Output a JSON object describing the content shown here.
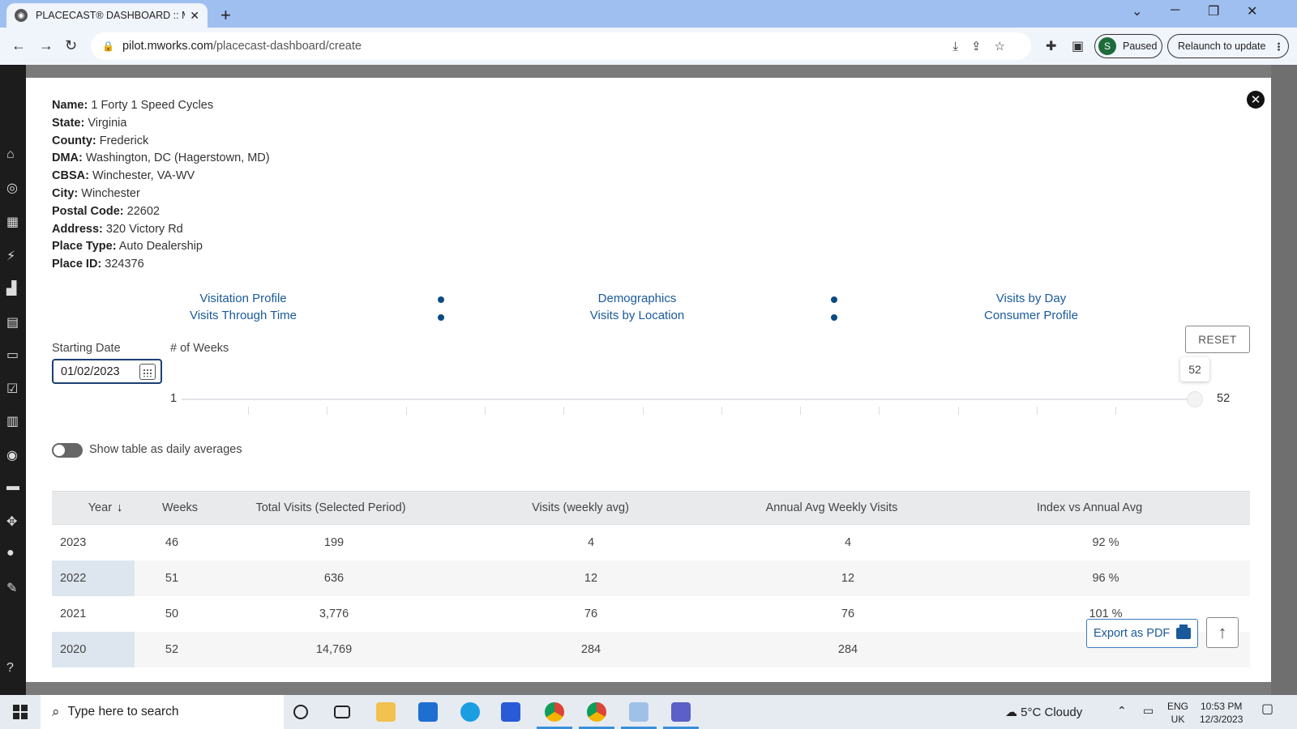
{
  "browser": {
    "tab_title": "PLACECAST® DASHBOARD :: M",
    "url_host": "pilot.mworks.com",
    "url_path": "/placecast-dashboard/create",
    "profile_initial": "S",
    "profile_status": "Paused",
    "relaunch_label": "Relaunch to update"
  },
  "place": {
    "fields": [
      {
        "label": "Name:",
        "value": "1 Forty 1 Speed Cycles"
      },
      {
        "label": "State:",
        "value": "Virginia"
      },
      {
        "label": "County:",
        "value": "Frederick"
      },
      {
        "label": "DMA:",
        "value": "Washington, DC (Hagerstown, MD)"
      },
      {
        "label": "CBSA:",
        "value": "Winchester, VA-WV"
      },
      {
        "label": "City:",
        "value": "Winchester"
      },
      {
        "label": "Postal Code:",
        "value": "22602"
      },
      {
        "label": "Address:",
        "value": "320 Victory Rd"
      },
      {
        "label": "Place Type:",
        "value": "Auto Dealership"
      },
      {
        "label": "Place ID:",
        "value": "324376"
      }
    ]
  },
  "sections": {
    "visitation_profile": "Visitation Profile",
    "demographics": "Demographics",
    "visits_by_day": "Visits by Day",
    "visits_through_time": "Visits Through Time",
    "visits_by_location": "Visits by Location",
    "consumer_profile": "Consumer Profile"
  },
  "controls": {
    "reset_label": "RESET",
    "starting_date_label": "Starting Date",
    "starting_date_value": "01/02/2023",
    "weeks_label": "# of Weeks",
    "slider_min": "1",
    "slider_max": "52",
    "slider_value": "52",
    "toggle_label": "Show table as daily averages",
    "toggle_on": false
  },
  "table": {
    "headers": [
      "Year",
      "Weeks",
      "Total Visits (Selected Period)",
      "Visits (weekly avg)",
      "Annual Avg Weekly Visits",
      "Index vs Annual Avg"
    ],
    "rows": [
      [
        "2023",
        "46",
        "199",
        "4",
        "4",
        "92 %"
      ],
      [
        "2022",
        "51",
        "636",
        "12",
        "12",
        "96 %"
      ],
      [
        "2021",
        "50",
        "3,776",
        "76",
        "76",
        "101 %"
      ],
      [
        "2020",
        "52",
        "14,769",
        "284",
        "284",
        ""
      ]
    ]
  },
  "actions": {
    "export_label": "Export as PDF"
  },
  "taskbar": {
    "search_placeholder": "Type here to search",
    "weather": "5°C  Cloudy",
    "lang_line1": "ENG",
    "lang_line2": "UK",
    "time": "10:53 PM",
    "date": "12/3/2023"
  },
  "colors": {
    "link": "#1a5a9a",
    "dot": "#0b4b82",
    "input_border": "#1c3f73"
  }
}
